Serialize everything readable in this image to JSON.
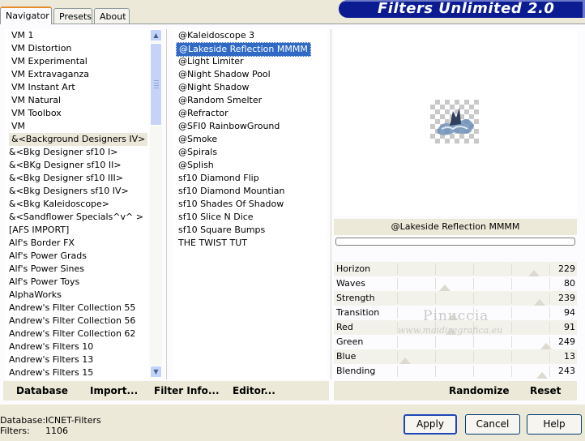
{
  "tabs": [
    "Navigator",
    "Presets",
    "About"
  ],
  "app_title": "Filters Unlimited 2.0",
  "categories": [
    "VM 1",
    "VM Distortion",
    "VM Experimental",
    "VM Extravaganza",
    "VM Instant Art",
    "VM Natural",
    "VM Toolbox",
    "VM",
    "&<Background Designers IV>",
    "&<Bkg Designer sf10 I>",
    "&<BKg Designer sf10 II>",
    "&<Bkg Designer sf10 III>",
    "&<Bkg Designers sf10 IV>",
    "&<Bkg Kaleidoscope>",
    "&<Sandflower Specials^v^ >",
    "[AFS IMPORT]",
    "Alf's Border FX",
    "Alf's Power Grads",
    "Alf's Power Sines",
    "Alf's Power Toys",
    "AlphaWorks",
    "Andrew's Filter Collection 55",
    "Andrew's Filter Collection 56",
    "Andrew's Filter Collection 62",
    "Andrew's Filters 10",
    "Andrew's Filters 13",
    "Andrew's Filters 15"
  ],
  "selected_category_index": 8,
  "filters": [
    "@Kaleidoscope 3",
    "@Lakeside Reflection MMMM",
    "@Light Limiter",
    "@Night Shadow Pool",
    "@Night Shadow",
    "@Random Smelter",
    "@Refractor",
    "@SFI0 RainbowGround",
    "@Smoke",
    "@Spirals",
    "@Splish",
    "sf10 Diamond Flip",
    "sf10 Diamond Mountian",
    "sf10 Shades Of Shadow",
    "sf10 Slice N Dice",
    "sf10 Square Bumps",
    "THE TWIST TUT"
  ],
  "selected_filter_index": 1,
  "current_filter_name": "@Lakeside Reflection MMMM",
  "sliders": [
    {
      "label": "Horizon",
      "value": 229
    },
    {
      "label": "Waves",
      "value": 80
    },
    {
      "label": "Strength",
      "value": 239
    },
    {
      "label": "Transition",
      "value": 94
    },
    {
      "label": "Red",
      "value": 91
    },
    {
      "label": "Green",
      "value": 249
    },
    {
      "label": "Blue",
      "value": 13
    },
    {
      "label": "Blending",
      "value": 243
    }
  ],
  "watermark": {
    "line1": "Pinuccia",
    "line2": "www.maidiregrafica.eu"
  },
  "links": {
    "database": "Database",
    "import": "Import...",
    "filter_info": "Filter Info...",
    "editor": "Editor...",
    "randomize": "Randomize",
    "reset": "Reset"
  },
  "footer": {
    "database_label": "Database:",
    "database_value": "ICNET-Filters",
    "filters_label": "Filters:",
    "filters_value": "1106"
  },
  "buttons": {
    "apply": "Apply",
    "cancel": "Cancel",
    "help": "Help"
  },
  "colors": {
    "banner": "#0b1c93",
    "selection": "#316ac5",
    "active_tab_border": "#e68b2c"
  }
}
